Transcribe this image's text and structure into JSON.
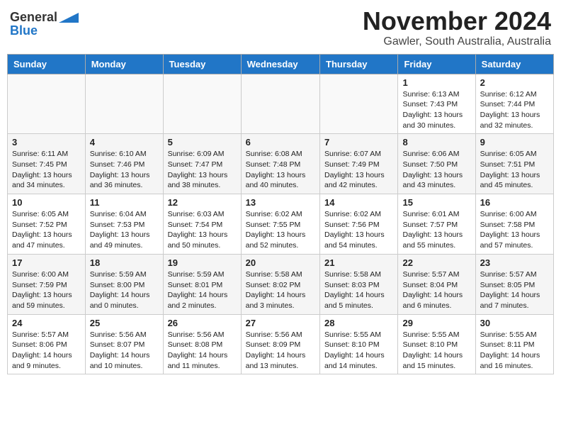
{
  "header": {
    "logo_general": "General",
    "logo_blue": "Blue",
    "title": "November 2024",
    "subtitle": "Gawler, South Australia, Australia"
  },
  "calendar": {
    "days_of_week": [
      "Sunday",
      "Monday",
      "Tuesday",
      "Wednesday",
      "Thursday",
      "Friday",
      "Saturday"
    ],
    "weeks": [
      [
        {
          "day": "",
          "info": ""
        },
        {
          "day": "",
          "info": ""
        },
        {
          "day": "",
          "info": ""
        },
        {
          "day": "",
          "info": ""
        },
        {
          "day": "",
          "info": ""
        },
        {
          "day": "1",
          "info": "Sunrise: 6:13 AM\nSunset: 7:43 PM\nDaylight: 13 hours\nand 30 minutes."
        },
        {
          "day": "2",
          "info": "Sunrise: 6:12 AM\nSunset: 7:44 PM\nDaylight: 13 hours\nand 32 minutes."
        }
      ],
      [
        {
          "day": "3",
          "info": "Sunrise: 6:11 AM\nSunset: 7:45 PM\nDaylight: 13 hours\nand 34 minutes."
        },
        {
          "day": "4",
          "info": "Sunrise: 6:10 AM\nSunset: 7:46 PM\nDaylight: 13 hours\nand 36 minutes."
        },
        {
          "day": "5",
          "info": "Sunrise: 6:09 AM\nSunset: 7:47 PM\nDaylight: 13 hours\nand 38 minutes."
        },
        {
          "day": "6",
          "info": "Sunrise: 6:08 AM\nSunset: 7:48 PM\nDaylight: 13 hours\nand 40 minutes."
        },
        {
          "day": "7",
          "info": "Sunrise: 6:07 AM\nSunset: 7:49 PM\nDaylight: 13 hours\nand 42 minutes."
        },
        {
          "day": "8",
          "info": "Sunrise: 6:06 AM\nSunset: 7:50 PM\nDaylight: 13 hours\nand 43 minutes."
        },
        {
          "day": "9",
          "info": "Sunrise: 6:05 AM\nSunset: 7:51 PM\nDaylight: 13 hours\nand 45 minutes."
        }
      ],
      [
        {
          "day": "10",
          "info": "Sunrise: 6:05 AM\nSunset: 7:52 PM\nDaylight: 13 hours\nand 47 minutes."
        },
        {
          "day": "11",
          "info": "Sunrise: 6:04 AM\nSunset: 7:53 PM\nDaylight: 13 hours\nand 49 minutes."
        },
        {
          "day": "12",
          "info": "Sunrise: 6:03 AM\nSunset: 7:54 PM\nDaylight: 13 hours\nand 50 minutes."
        },
        {
          "day": "13",
          "info": "Sunrise: 6:02 AM\nSunset: 7:55 PM\nDaylight: 13 hours\nand 52 minutes."
        },
        {
          "day": "14",
          "info": "Sunrise: 6:02 AM\nSunset: 7:56 PM\nDaylight: 13 hours\nand 54 minutes."
        },
        {
          "day": "15",
          "info": "Sunrise: 6:01 AM\nSunset: 7:57 PM\nDaylight: 13 hours\nand 55 minutes."
        },
        {
          "day": "16",
          "info": "Sunrise: 6:00 AM\nSunset: 7:58 PM\nDaylight: 13 hours\nand 57 minutes."
        }
      ],
      [
        {
          "day": "17",
          "info": "Sunrise: 6:00 AM\nSunset: 7:59 PM\nDaylight: 13 hours\nand 59 minutes."
        },
        {
          "day": "18",
          "info": "Sunrise: 5:59 AM\nSunset: 8:00 PM\nDaylight: 14 hours\nand 0 minutes."
        },
        {
          "day": "19",
          "info": "Sunrise: 5:59 AM\nSunset: 8:01 PM\nDaylight: 14 hours\nand 2 minutes."
        },
        {
          "day": "20",
          "info": "Sunrise: 5:58 AM\nSunset: 8:02 PM\nDaylight: 14 hours\nand 3 minutes."
        },
        {
          "day": "21",
          "info": "Sunrise: 5:58 AM\nSunset: 8:03 PM\nDaylight: 14 hours\nand 5 minutes."
        },
        {
          "day": "22",
          "info": "Sunrise: 5:57 AM\nSunset: 8:04 PM\nDaylight: 14 hours\nand 6 minutes."
        },
        {
          "day": "23",
          "info": "Sunrise: 5:57 AM\nSunset: 8:05 PM\nDaylight: 14 hours\nand 7 minutes."
        }
      ],
      [
        {
          "day": "24",
          "info": "Sunrise: 5:57 AM\nSunset: 8:06 PM\nDaylight: 14 hours\nand 9 minutes."
        },
        {
          "day": "25",
          "info": "Sunrise: 5:56 AM\nSunset: 8:07 PM\nDaylight: 14 hours\nand 10 minutes."
        },
        {
          "day": "26",
          "info": "Sunrise: 5:56 AM\nSunset: 8:08 PM\nDaylight: 14 hours\nand 11 minutes."
        },
        {
          "day": "27",
          "info": "Sunrise: 5:56 AM\nSunset: 8:09 PM\nDaylight: 14 hours\nand 13 minutes."
        },
        {
          "day": "28",
          "info": "Sunrise: 5:55 AM\nSunset: 8:10 PM\nDaylight: 14 hours\nand 14 minutes."
        },
        {
          "day": "29",
          "info": "Sunrise: 5:55 AM\nSunset: 8:10 PM\nDaylight: 14 hours\nand 15 minutes."
        },
        {
          "day": "30",
          "info": "Sunrise: 5:55 AM\nSunset: 8:11 PM\nDaylight: 14 hours\nand 16 minutes."
        }
      ]
    ]
  }
}
